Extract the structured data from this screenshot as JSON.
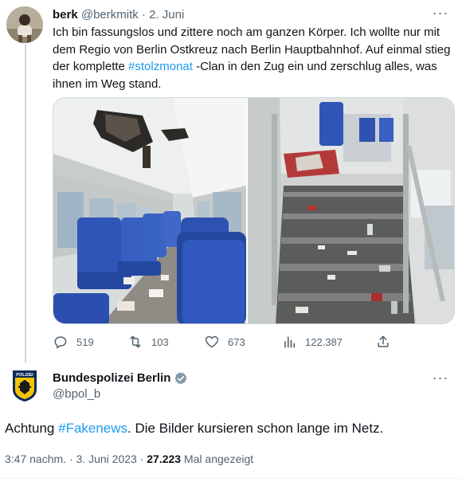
{
  "reply_tweet": {
    "display_name": "berk",
    "handle": "@berkmitk",
    "separator": "·",
    "date": "2. Juni",
    "text_before": "Ich bin fassungslos und zittere noch am ganzen Körper. Ich wollte nur mit dem Regio von Berlin Ostkreuz nach Berlin Hauptbahnhof. Auf einmal stieg der komplette ",
    "hashtag": "#stolzmonat",
    "text_after": " -Clan in den Zug ein und zerschlug alles, was ihnen im Weg stand.",
    "replies": "519",
    "retweets": "103",
    "likes": "673",
    "views": "122.387",
    "more": "···"
  },
  "main_tweet": {
    "display_name": "Bundespolizei Berlin",
    "handle": "@bpol_b",
    "text_before": "Achtung ",
    "hashtag": "#Fakenews",
    "text_after": ". Die Bilder kursieren schon lange im Netz.",
    "time": "3:47 nachm.",
    "separator": "·",
    "date": "3. Juni 2023",
    "view_count": "27.223",
    "view_label": "Mal angezeigt",
    "more": "···",
    "logo_text": "POLIZEI"
  },
  "colors": {
    "accent": "#1d9bf0",
    "text": "#0f1419",
    "secondary": "#536471",
    "seat_blue": "#2f55b8",
    "verified_gray": "#829aab"
  }
}
